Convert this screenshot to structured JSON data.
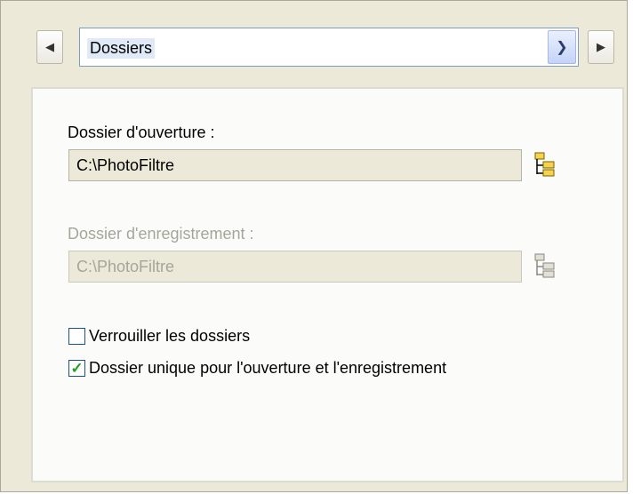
{
  "nav": {
    "prev_icon": "chevron-left-icon",
    "next_icon": "chevron-right-icon",
    "dropdown_icon": "chevron-down-icon",
    "category_selected": "Dossiers"
  },
  "open_folder": {
    "label": "Dossier d'ouverture :",
    "value": "C:\\PhotoFiltre",
    "enabled": true,
    "browse_icon": "folder-tree-icon"
  },
  "save_folder": {
    "label": "Dossier d'enregistrement :",
    "value": "C:\\PhotoFiltre",
    "enabled": false,
    "browse_icon": "folder-tree-icon"
  },
  "options": {
    "lock_folders": {
      "label": "Verrouiller les dossiers",
      "checked": false
    },
    "single_folder": {
      "label": "Dossier unique pour l'ouverture et l'enregistrement",
      "checked": true
    }
  },
  "colors": {
    "window_bg": "#ece9d8",
    "panel_bg": "#fbfbf9",
    "check_mark": "#21a121",
    "disabled_text": "#a6a59b"
  }
}
